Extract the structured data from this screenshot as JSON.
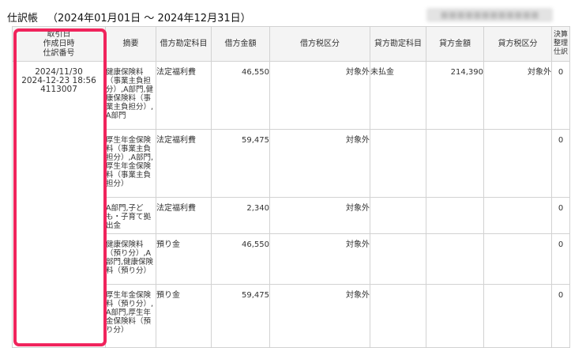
{
  "title": "仕訳帳",
  "period": "（2024年01月01日 〜 2024年12月31日）",
  "company_name": "■■■■■■■■■■■■",
  "headers": {
    "date_line1": "取引日",
    "date_line2": "作成日時",
    "date_line3": "仕訳番号",
    "desc": "摘要",
    "debit_account": "借方勘定科目",
    "debit_amount": "借方金額",
    "debit_tax": "借方税区分",
    "credit_account": "貸方勘定科目",
    "credit_amount": "貸方金額",
    "credit_tax": "貸方税区分",
    "settlement": "決算整理仕訳"
  },
  "entry": {
    "date": "2024/11/30",
    "created": "2024-12-23 18:56",
    "number": "4113007"
  },
  "rows": [
    {
      "desc": "健康保険料（事業主負担分）,A部門,健康保険料（事業主負担分）,A部門",
      "debit_account": "法定福利費",
      "debit_amount": "46,550",
      "debit_tax": "対象外",
      "credit_account": "未払金",
      "credit_amount": "214,390",
      "credit_tax": "対象外",
      "settlement": "0"
    },
    {
      "desc": "厚生年金保険料（事業主負担分）,A部門,厚生年金保険料（事業主負担分）",
      "debit_account": "法定福利費",
      "debit_amount": "59,475",
      "debit_tax": "対象外",
      "credit_account": "",
      "credit_amount": "",
      "credit_tax": "",
      "settlement": "0"
    },
    {
      "desc": "A部門,子ども・子育て拠出金",
      "debit_account": "法定福利費",
      "debit_amount": "2,340",
      "debit_tax": "対象外",
      "credit_account": "",
      "credit_amount": "",
      "credit_tax": "",
      "settlement": "0"
    },
    {
      "desc": "健康保険料（預り分）,A部門,健康保険料（預り分）",
      "debit_account": "預り金",
      "debit_amount": "46,550",
      "debit_tax": "対象外",
      "credit_account": "",
      "credit_amount": "",
      "credit_tax": "",
      "settlement": "0"
    },
    {
      "desc": "厚生年金保険料（預り分）,A部門,厚生年金保険料（預り分）",
      "debit_account": "預り金",
      "debit_amount": "59,475",
      "debit_tax": "対象外",
      "credit_account": "",
      "credit_amount": "",
      "credit_tax": "",
      "settlement": "0"
    }
  ],
  "highlight_color": "#f0245c"
}
